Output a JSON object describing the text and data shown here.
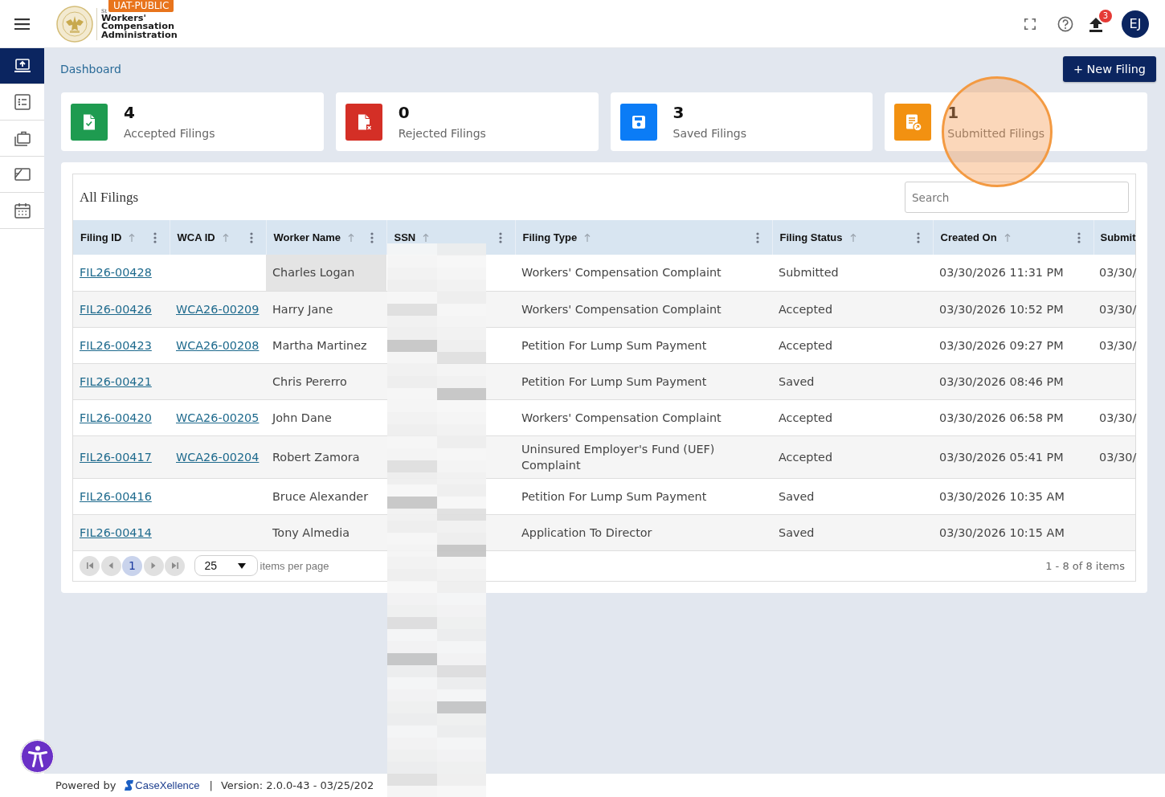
{
  "header": {
    "logo": {
      "subtitle": "St",
      "lines": [
        "Workers'",
        "Compensation",
        "Administration"
      ]
    },
    "environment_badge": "UAT-PUBLIC",
    "upload_badge": "3",
    "avatar_initials": "EJ"
  },
  "sidebar": {
    "items": [
      {
        "selected": true
      },
      {
        "selected": false
      },
      {
        "selected": false
      },
      {
        "selected": false
      },
      {
        "selected": false
      }
    ]
  },
  "breadcrumb": "Dashboard",
  "new_filing_button": "+ New Filing",
  "stat_cards": [
    {
      "kind": "accepted",
      "count": "4",
      "label": "Accepted Filings",
      "color": "#1e9b50",
      "highlighted": false
    },
    {
      "kind": "rejected",
      "count": "0",
      "label": "Rejected Filings",
      "color": "#d42f26",
      "highlighted": false
    },
    {
      "kind": "saved",
      "count": "3",
      "label": "Saved Filings",
      "color": "#0b7cf6",
      "highlighted": false
    },
    {
      "kind": "submitted",
      "count": "1",
      "label": "Submitted Filings",
      "color": "#f29111",
      "highlighted": true
    }
  ],
  "filings_table": {
    "title": "All Filings",
    "search": {
      "placeholder": "Search"
    },
    "columns": [
      {
        "label": "Filing ID",
        "kind": "link"
      },
      {
        "label": "WCA ID",
        "kind": "link"
      },
      {
        "label": "Worker Name",
        "kind": "text"
      },
      {
        "label": "SSN",
        "kind": "redacted"
      },
      {
        "label": "Filing Type",
        "kind": "text"
      },
      {
        "label": "Filing Status",
        "kind": "text"
      },
      {
        "label": "Created On",
        "kind": "text"
      },
      {
        "label": "Submit",
        "kind": "clipped"
      }
    ],
    "rows": [
      {
        "filing_id": "FIL26-00428",
        "worker_name": "Charles Logan",
        "filing_type": "Workers' Compensation Complaint",
        "filing_status": "Submitted",
        "created_on": "03/30/2026 11:31 PM",
        "submitted_on": "03/30/",
        "name_hovered": true
      },
      {
        "filing_id": "FIL26-00426",
        "wca_id": "WCA26-00209",
        "worker_name": "Harry Jane",
        "filing_type": "Workers' Compensation Complaint",
        "filing_status": "Accepted",
        "created_on": "03/30/2026 10:52 PM",
        "submitted_on": "03/30/",
        "name_hovered": false
      },
      {
        "filing_id": "FIL26-00423",
        "wca_id": "WCA26-00208",
        "worker_name": "Martha Martinez",
        "filing_type": "Petition For Lump Sum Payment",
        "filing_status": "Accepted",
        "created_on": "03/30/2026 09:27 PM",
        "submitted_on": "03/30/",
        "name_hovered": false
      },
      {
        "filing_id": "FIL26-00421",
        "worker_name": "Chris Pererro",
        "filing_type": "Petition For Lump Sum Payment",
        "filing_status": "Saved",
        "created_on": "03/30/2026 08:46 PM",
        "name_hovered": false
      },
      {
        "filing_id": "FIL26-00420",
        "wca_id": "WCA26-00205",
        "worker_name": "John Dane",
        "filing_type": "Workers' Compensation Complaint",
        "filing_status": "Accepted",
        "created_on": "03/30/2026 06:58 PM",
        "submitted_on": "03/30/",
        "name_hovered": false
      },
      {
        "filing_id": "FIL26-00417",
        "wca_id": "WCA26-00204",
        "worker_name": "Robert Zamora",
        "filing_type": "Uninsured Employer's Fund (UEF) Complaint",
        "filing_status": "Accepted",
        "created_on": "03/30/2026 05:41 PM",
        "submitted_on": "03/30/",
        "name_hovered": false
      },
      {
        "filing_id": "FIL26-00416",
        "worker_name": "Bruce Alexander",
        "filing_type": "Petition For Lump Sum Payment",
        "filing_status": "Saved",
        "created_on": "03/30/2026 10:35 AM",
        "name_hovered": false
      },
      {
        "filing_id": "FIL26-00414",
        "worker_name": "Tony Almedia",
        "filing_type": "Application To Director",
        "filing_status": "Saved",
        "created_on": "03/30/2026 10:15 AM",
        "name_hovered": false
      }
    ]
  },
  "pager": {
    "navigation_disabled": true,
    "pages": [
      {
        "label": "1",
        "selected": true
      }
    ],
    "page_size": "25",
    "page_size_label": "items per page",
    "summary": "1 - 8 of 8 items"
  },
  "footer": {
    "powered_by": "Powered by",
    "brand": "CaseXellence",
    "separator": "|",
    "version": "Version: 2.0.0-43 - 03/25/202"
  }
}
